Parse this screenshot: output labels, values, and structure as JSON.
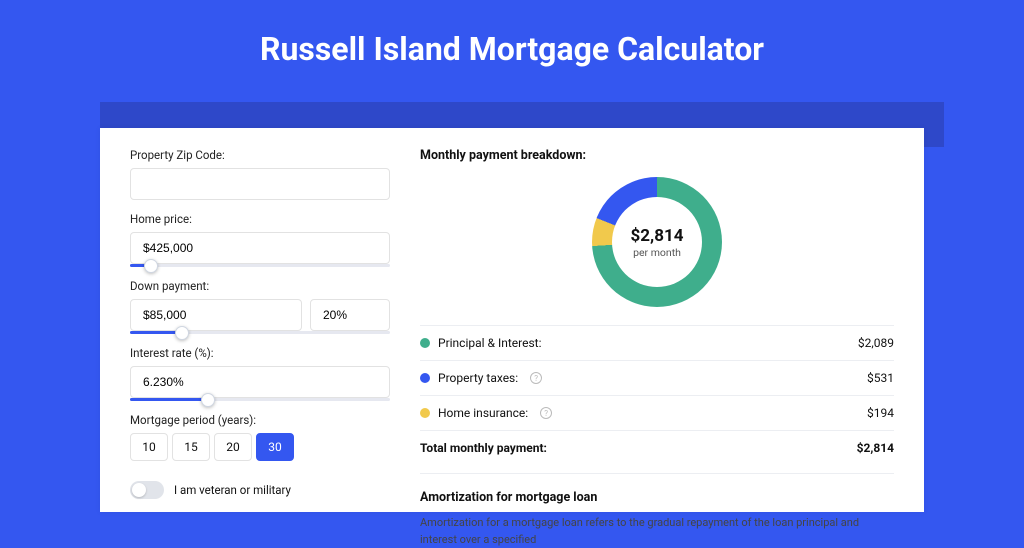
{
  "title": "Russell Island Mortgage Calculator",
  "form": {
    "zip": {
      "label": "Property Zip Code:",
      "value": ""
    },
    "price": {
      "label": "Home price:",
      "value": "$425,000",
      "slider_pct": 8
    },
    "down": {
      "label": "Down payment:",
      "value": "$85,000",
      "pct": "20%",
      "slider_pct": 20
    },
    "rate": {
      "label": "Interest rate (%):",
      "value": "6.230%",
      "slider_pct": 30
    },
    "period": {
      "label": "Mortgage period (years):",
      "options": [
        "10",
        "15",
        "20",
        "30"
      ],
      "selected": "30"
    },
    "veteran": {
      "label": "I am veteran or military",
      "value": false
    }
  },
  "breakdown": {
    "title": "Monthly payment breakdown:",
    "center_value": "$2,814",
    "center_label": "per month",
    "items": [
      {
        "name": "Principal & Interest:",
        "value": "$2,089",
        "color": "#3FAE8C",
        "info": false
      },
      {
        "name": "Property taxes:",
        "value": "$531",
        "color": "#3457F0",
        "info": true
      },
      {
        "name": "Home insurance:",
        "value": "$194",
        "color": "#F1C94C",
        "info": true
      }
    ],
    "total": {
      "name": "Total monthly payment:",
      "value": "$2,814"
    }
  },
  "amort": {
    "title": "Amortization for mortgage loan",
    "body": "Amortization for a mortgage loan refers to the gradual repayment of the loan principal and interest over a specified"
  },
  "chart_data": {
    "type": "pie",
    "title": "Monthly payment breakdown",
    "categories": [
      "Principal & Interest",
      "Property taxes",
      "Home insurance"
    ],
    "values": [
      2089,
      531,
      194
    ],
    "colors": [
      "#3FAE8C",
      "#3457F0",
      "#F1C94C"
    ],
    "total": 2814,
    "center_label": "$2,814 per month"
  }
}
